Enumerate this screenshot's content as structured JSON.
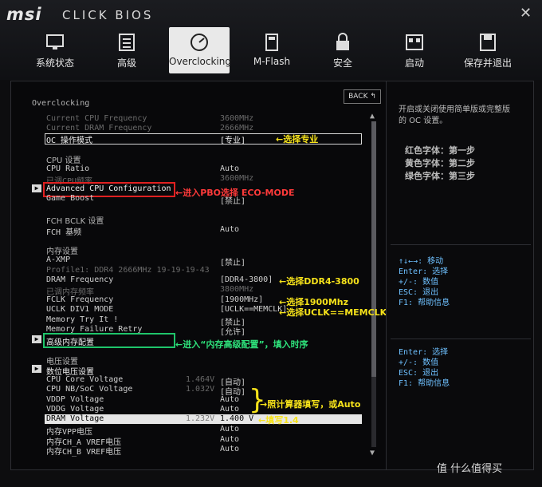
{
  "header": {
    "logo": "msi",
    "product": "CLICK BIOS",
    "close": "✕"
  },
  "tabs": [
    {
      "label": "系统状态",
      "icon": "monitor-icon",
      "active": false
    },
    {
      "label": "高级",
      "icon": "settings-board-icon",
      "active": false
    },
    {
      "label": "Overclocking",
      "icon": "gauge-icon",
      "active": true
    },
    {
      "label": "M-Flash",
      "icon": "usb-drive-icon",
      "active": false
    },
    {
      "label": "安全",
      "icon": "lock-icon",
      "active": false
    },
    {
      "label": "启动",
      "icon": "boot-icon",
      "active": false
    },
    {
      "label": "保存并退出",
      "icon": "floppy-icon",
      "active": false
    }
  ],
  "panel": {
    "title": "Overclocking",
    "back": "BACK",
    "rows": {
      "cur_cpu": {
        "label": "Current CPU Frequency",
        "value": "3600MHz"
      },
      "cur_dram": {
        "label": "Current DRAM Frequency",
        "value": "2666MHz"
      },
      "oc_mode": {
        "label": "OC 操作模式",
        "value": "[专业]"
      },
      "cpu_section": "CPU 设置",
      "cpu_ratio": {
        "label": "CPU Ratio",
        "value": "Auto"
      },
      "cpu_adj": {
        "label": "已调CPU频率",
        "value": "3600MHz"
      },
      "adv_cpu": {
        "label": "Advanced CPU Configuration"
      },
      "game_boost": {
        "label": "Game Boost",
        "value": "[禁止]"
      },
      "fch_section": "FCH BCLK 设置",
      "fch_base": {
        "label": "FCH 基频",
        "value": "Auto"
      },
      "mem_section": "内存设置",
      "axmp": {
        "label": "A-XMP",
        "value": "[禁止]"
      },
      "profile1": {
        "label": "Profile1: DDR4 2666MHz 19-19-19-43"
      },
      "dram_freq": {
        "label": "DRAM Frequency",
        "value": "[DDR4-3800]"
      },
      "dram_adj": {
        "label": "已调内存频率",
        "value": "3800MHz"
      },
      "fclk": {
        "label": "FCLK Frequency",
        "value": "[1900MHz]"
      },
      "uclk": {
        "label": "UCLK DIV1 MODE",
        "value": "[UCLK==MEMCLK]"
      },
      "mem_try": {
        "label": "Memory Try It !",
        "value": "[禁止]"
      },
      "mem_fail": {
        "label": "Memory Failure Retry",
        "value": "[允许]"
      },
      "adv_mem": {
        "label": "高级内存配置"
      },
      "volt_section": "电压设置",
      "digital_volt": {
        "label": "数位电压设置"
      },
      "cpu_core": {
        "label": "CPU Core Voltage",
        "cur": "1.464V",
        "value": "[自动]"
      },
      "cpu_nb": {
        "label": "CPU NB/SoC Voltage",
        "cur": "1.032V",
        "value": "[自动]"
      },
      "vddp": {
        "label": "VDDP Voltage",
        "value": "Auto"
      },
      "vddg": {
        "label": "VDDG Voltage",
        "value": "Auto"
      },
      "dram_volt": {
        "label": "DRAM Voltage",
        "cur": "1.232V",
        "value": "1.400 V"
      },
      "mem_vpp": {
        "label": "内存VPP电压",
        "value": "Auto"
      },
      "vref_a": {
        "label": "内存CH_A VREF电压",
        "value": "Auto"
      },
      "vref_b": {
        "label": "内存CH_B VREF电压",
        "value": "Auto"
      }
    }
  },
  "annotations": {
    "a1": "←选择专业",
    "a2": "←进入PBO选择 ECO-MODE",
    "a3": "←选择DDR4-3800",
    "a4": "←选择1900Mhz",
    "a5": "←选择UCLK==MEMCLK",
    "a6": "←进入“内存高级配置”，填入时序",
    "a7": "→照计算器填写，或Auto",
    "a8": "←填写1.4"
  },
  "right": {
    "desc1": "开启或关闭使用简单版或完整版",
    "desc2": "的 OC 设置。",
    "legend_red": "红色字体：第一步",
    "legend_yellow": "黄色字体：第二步",
    "legend_green": "绿色字体：第三步",
    "help1": [
      "↑↓←→: 移动",
      "Enter: 选择",
      "+/-: 数值",
      "ESC: 退出",
      "F1: 帮助信息"
    ],
    "help2": [
      "Enter: 选择",
      "+/-: 数值",
      "ESC: 退出",
      "F1: 帮助信息"
    ]
  },
  "watermark": "值 什么值得买",
  "colors": {
    "red": "#ff3a3a",
    "yellow": "#f6e21a",
    "green": "#2ee07a",
    "help": "#6ec0ff"
  }
}
